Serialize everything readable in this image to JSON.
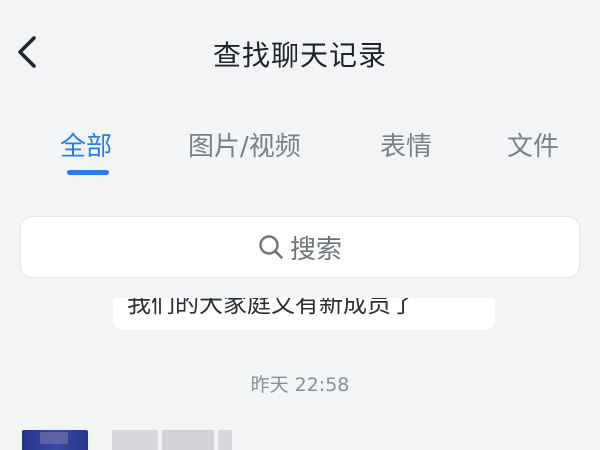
{
  "header": {
    "title": "查找聊天记录",
    "back_icon": "chevron-left-icon"
  },
  "tabs": [
    {
      "label": "全部",
      "active": true
    },
    {
      "label": "图片/视频",
      "active": false
    },
    {
      "label": "表情",
      "active": false
    },
    {
      "label": "文件",
      "active": false
    }
  ],
  "search": {
    "placeholder": "搜索",
    "icon": "search-icon"
  },
  "messages": [
    {
      "text": "我们的大家庭又有新成员了"
    }
  ],
  "timestamp": "昨天 22:58",
  "colors": {
    "accent": "#2a7ce9",
    "background": "#f3f4f6",
    "text_primary": "#1f2329",
    "text_secondary": "#7b8087"
  }
}
